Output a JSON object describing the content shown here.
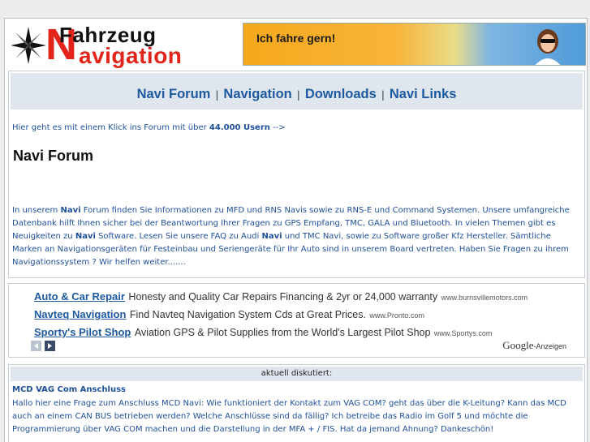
{
  "logo": {
    "line1": "Fahrzeug",
    "big_letter": "N",
    "line2": "avigation"
  },
  "banner": {
    "text": "Ich fahre gern!"
  },
  "nav": {
    "items": [
      "Navi Forum",
      "Navigation",
      "Downloads",
      "Navi Links"
    ],
    "separator": "|"
  },
  "intro": {
    "prefix": "Hier geht es mit einem Klick ins Forum mit über ",
    "count": "44.000 Usern",
    "suffix": " -->"
  },
  "section_title": "Navi Forum",
  "description": {
    "p1": "In unserem ",
    "b1": "Navi",
    "p2": " Forum finden Sie Informationen zu MFD und RNS Navis sowie zu RNS-E und Command Systemen. Unsere umfangreiche Datenbank hilft Ihnen sicher bei der Beantwortung Ihrer Fragen zu GPS Empfang, TMC, GALA und Bluetooth. In vielen Themen gibt es Neuigkeiten zu ",
    "b2": "Navi",
    "p3": " Software. Lesen Sie unsere FAQ zu Audi ",
    "b3": "Navi",
    "p4": " und TMC Navi, sowie zu Software großer Kfz Hersteller. Sämtliche Marken an Navigationsgeräten für Festeinbau und Seriengeräte für Ihr Auto sind in unserem Board vertreten. Haben Sie Fragen zu ihrem Navigationssystem ? Wir helfen weiter......."
  },
  "ads": [
    {
      "title": "Auto & Car Repair",
      "text": "Honesty and Quality Car Repairs Financing & 2yr or 24,000 warranty",
      "url": "www.burnsvillemotors.com"
    },
    {
      "title": "Navteq Navigation",
      "text": "Find Navteq Navigation System Cds at Great Prices.",
      "url": "www.Pronto.com"
    },
    {
      "title": "Sporty's Pilot Shop",
      "text": "Aviation GPS & Pilot Supplies from the World's Largest Pilot Shop",
      "url": "www.Sportys.com"
    }
  ],
  "ads_label": {
    "brand": "Google",
    "suffix": "-Anzeigen"
  },
  "discussion": {
    "header": "aktuell diskutiert:",
    "title": "MCD VAG Com Anschluss",
    "body": "Hallo hier eine Frage zum Anschluss MCD Navi: Wie funktioniert der Kontakt zum VAG COM? geht das über die K-Leitung? Kann das MCD auch an einem CAN BUS betrieben werden? Welche Anschlüsse sind da fällig? Ich betreibe das Radio im Golf 5 und möchte die Programmierung über VAG COM machen und die Darstellung in der MFA + / FIS. Hat da jemand Ahnung? Dankeschön!"
  },
  "colors": {
    "link": "#1e5aa0",
    "logo_red": "#e2241b",
    "bar_bg": "#dfe6ee"
  },
  "icons": [
    "compass-rose-icon",
    "prev-arrow-icon",
    "next-arrow-icon"
  ]
}
